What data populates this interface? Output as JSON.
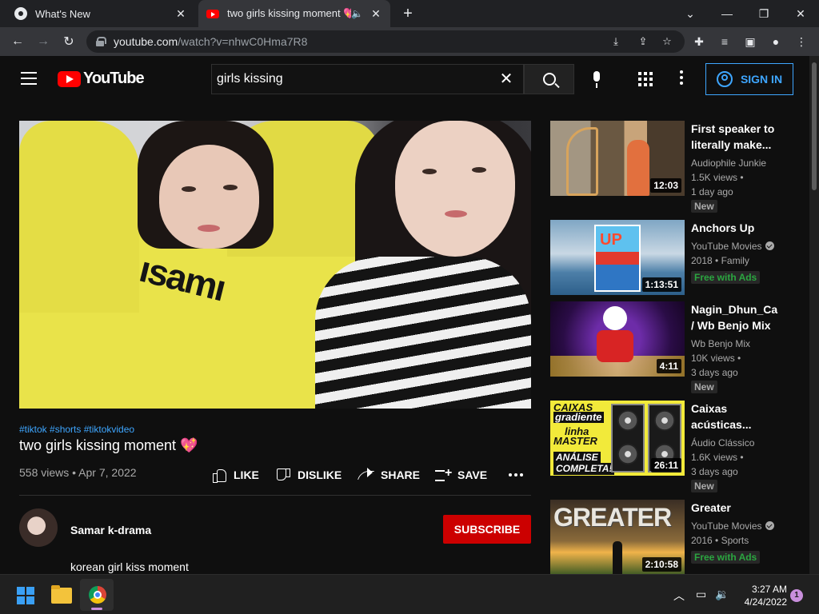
{
  "browser": {
    "tabs": [
      {
        "title": "What's New",
        "icon": "chrome-icon",
        "active": false
      },
      {
        "title": "two girls kissing moment 💖",
        "icon": "youtube-icon",
        "active": true
      }
    ],
    "url_host": "youtube.com",
    "url_path": "/watch?v=nhwC0Hma7R8"
  },
  "youtube": {
    "logo_text": "YouTube",
    "search_query": "girls kissing",
    "sign_in_label": "SIGN IN",
    "video": {
      "hashtags": "#tiktok #shorts #tiktokvideo",
      "title": "two girls kissing moment 💖",
      "views_date": "558 views • Apr 7, 2022",
      "frame_print": "ısamı"
    },
    "actions": {
      "like": "LIKE",
      "dislike": "DISLIKE",
      "share": "SHARE",
      "save": "SAVE"
    },
    "channel": {
      "name": "Samar k-drama",
      "subscribe_label": "SUBSCRIBE",
      "description": "korean girl kiss moment"
    },
    "recommendations": [
      {
        "title": "First speaker to literally make...",
        "title_line1": "First speaker to",
        "title_line2": "literally make...",
        "channel": "Audiophile Junkie",
        "line2": "1.5K views •",
        "line3": "1 day ago",
        "badge": "New",
        "duration": "12:03"
      },
      {
        "title": "Anchors Up",
        "channel": "YouTube Movies",
        "line2": "2018 • Family",
        "badge": "Free with Ads",
        "duration": "1:13:51",
        "thumb_text": "UP"
      },
      {
        "title_line1": "Nagin_Dhun_Ca",
        "title_line2": "/ Wb Benjo Mix",
        "channel": "Wb Benjo Mix",
        "line2": "10K views •",
        "line3": "3 days ago",
        "badge": "New",
        "duration": "4:11"
      },
      {
        "title_line1": "Caixas",
        "title_line2": "acústicas...",
        "channel": "Áudio Clássico",
        "line2": "1.6K views •",
        "line3": "3 days ago",
        "badge": "New",
        "duration": "26:11",
        "thumb_lines": [
          "CAIXAS",
          "gradiente",
          "linha",
          "MASTER",
          "ANÁLISE",
          "COMPLETA!"
        ]
      },
      {
        "title": "Greater",
        "channel": "YouTube Movies",
        "line2": "2016 • Sports",
        "badge": "Free with Ads",
        "duration": "2:10:58",
        "thumb_text": "GREATER"
      }
    ]
  },
  "taskbar": {
    "time": "3:27 AM",
    "date": "4/24/2022",
    "notification_count": "1"
  },
  "colors": {
    "youtube_red": "#ff0000",
    "subscribe_red": "#cc0000",
    "link_blue": "#3ea6ff",
    "free_green": "#2ba640"
  }
}
